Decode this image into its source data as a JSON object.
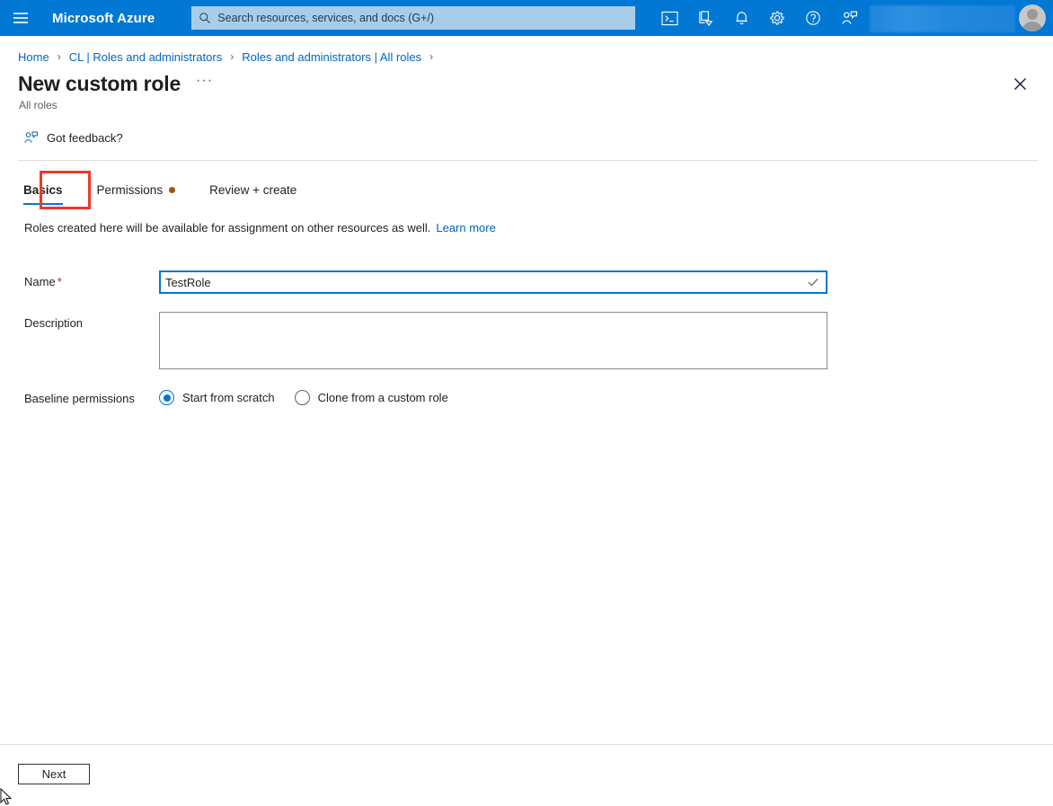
{
  "header": {
    "brand": "Microsoft Azure",
    "menu_icon": "hamburger-icon",
    "search": {
      "placeholder": "Search resources, services, and docs (G+/)",
      "icon": "search-icon"
    },
    "icons": [
      {
        "name": "cloud-shell-icon"
      },
      {
        "name": "directory-switch-icon"
      },
      {
        "name": "notifications-bell-icon"
      },
      {
        "name": "settings-gear-icon"
      },
      {
        "name": "help-question-icon"
      },
      {
        "name": "feedback-person-icon"
      }
    ],
    "avatar": "user-avatar",
    "accent_color": "#0078d4",
    "search_bg": "#a8cdea"
  },
  "breadcrumb": {
    "items": [
      "Home",
      "CL | Roles and administrators",
      "Roles and administrators | All roles"
    ],
    "separator": "›"
  },
  "page": {
    "title": "New custom role",
    "more_label": "···",
    "subtitle": "All roles",
    "close_label": "✕"
  },
  "command_bar": {
    "feedback_label": "Got feedback?",
    "feedback_icon": "feedback-person-icon"
  },
  "tabs": [
    {
      "label": "Basics",
      "active": true,
      "dot": false
    },
    {
      "label": "Permissions",
      "active": false,
      "dot": true
    },
    {
      "label": "Review + create",
      "active": false,
      "dot": false
    }
  ],
  "highlight": {
    "target": "Basics",
    "color": "#f0372b"
  },
  "intro": {
    "text": "Roles created here will be available for assignment on other resources as well.",
    "link": "Learn more"
  },
  "form": {
    "name": {
      "label": "Name",
      "required_marker": "*",
      "value": "TestRole",
      "placeholder": "",
      "validation_icon": "checkmark-icon"
    },
    "description": {
      "label": "Description",
      "value": "",
      "placeholder": ""
    },
    "baseline": {
      "label": "Baseline permissions",
      "options": [
        {
          "label": "Start from scratch",
          "selected": true
        },
        {
          "label": "Clone from a custom role",
          "selected": false
        }
      ]
    }
  },
  "footer": {
    "next_label": "Next"
  },
  "colors": {
    "tab_underline": "#0078d4",
    "tab_dot": "#a4520d",
    "link": "#0066bf",
    "required": "#a4262c"
  }
}
